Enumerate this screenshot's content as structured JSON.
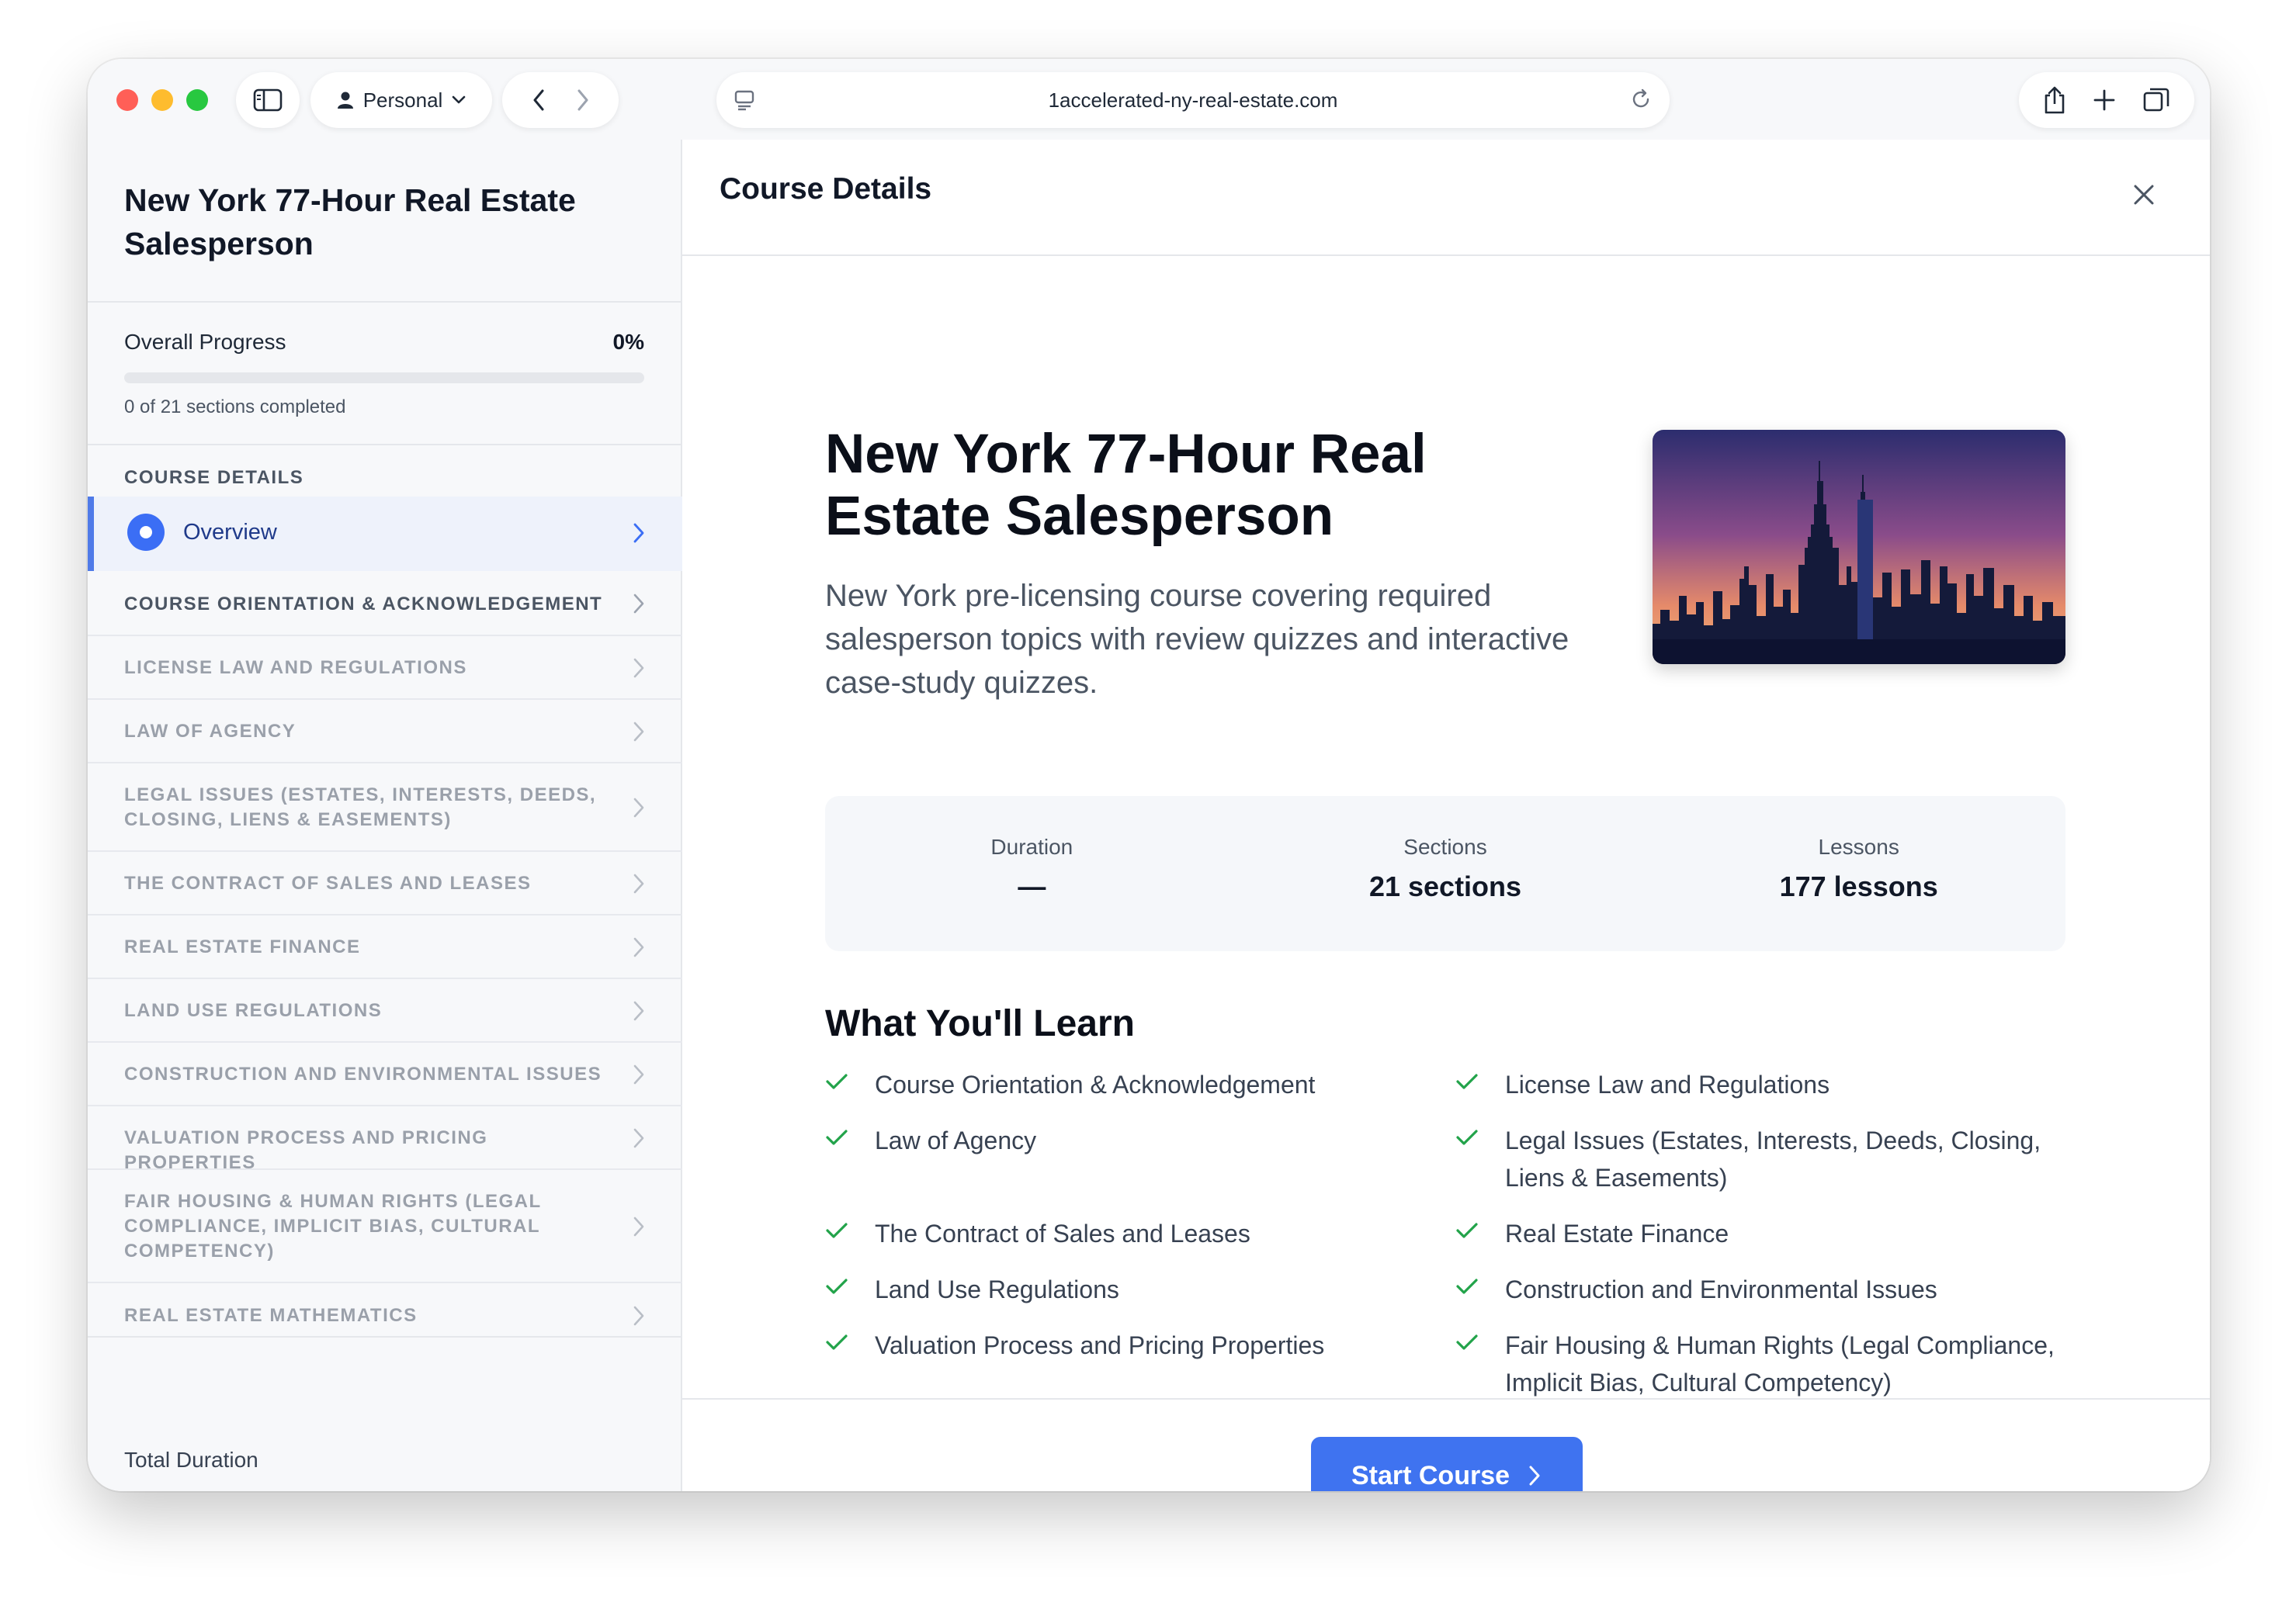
{
  "browser": {
    "profile_label": "Personal",
    "url": "1accelerated-ny-real-estate.com"
  },
  "sidebar": {
    "course_title": "New York 77-Hour Real Estate Salesperson",
    "progress_label": "Overall Progress",
    "progress_percent": "0%",
    "progress_fraction": 0,
    "progress_subtext": "0 of 21 sections completed",
    "section_header": "COURSE DETAILS",
    "overview_label": "Overview",
    "items": [
      "COURSE ORIENTATION & ACKNOWLEDGEMENT",
      "LICENSE LAW AND REGULATIONS",
      "LAW OF AGENCY",
      "LEGAL ISSUES (ESTATES, INTERESTS, DEEDS, CLOSING, LIENS & EASEMENTS)",
      "THE CONTRACT OF SALES AND LEASES",
      "REAL ESTATE FINANCE",
      "LAND USE REGULATIONS",
      "CONSTRUCTION AND ENVIRONMENTAL ISSUES",
      "VALUATION PROCESS AND PRICING PROPERTIES",
      "FAIR HOUSING & HUMAN RIGHTS (LEGAL COMPLIANCE, IMPLICIT BIAS, CULTURAL COMPETENCY)",
      "REAL ESTATE MATHEMATICS"
    ],
    "total_duration_label": "Total Duration",
    "total_duration_value": "—"
  },
  "main": {
    "header_title": "Course Details",
    "course_title": "New York 77-Hour Real Estate Salesperson",
    "course_description": "New York pre-licensing course covering required salesperson topics with review quizzes and interactive case-study quizzes.",
    "stats": [
      {
        "label": "Duration",
        "value": "—"
      },
      {
        "label": "Sections",
        "value": "21 sections"
      },
      {
        "label": "Lessons",
        "value": "177 lessons"
      }
    ],
    "learn_title": "What You'll Learn",
    "learn_items": [
      "Course Orientation & Acknowledgement",
      "License Law and Regulations",
      "Law of Agency",
      "Legal Issues (Estates, Interests, Deeds, Closing, Liens & Easements)",
      "The Contract of Sales and Leases",
      "Real Estate Finance",
      "Land Use Regulations",
      "Construction and Environmental Issues",
      "Valuation Process and Pricing Properties",
      "Fair Housing & Human Rights (Legal Compliance, Implicit Bias, Cultural Competency)"
    ],
    "start_button_label": "Start Course"
  },
  "colors": {
    "accent": "#3f73f0",
    "check": "#22a34a",
    "active_bg": "#eef2fb"
  },
  "icons": [
    "sidebar-toggle-icon",
    "person-icon",
    "chevron-down-icon",
    "back-icon",
    "forward-icon",
    "page-icon",
    "reload-icon",
    "share-icon",
    "plus-icon",
    "tabs-icon",
    "close-icon",
    "chevron-right-icon",
    "check-icon"
  ]
}
